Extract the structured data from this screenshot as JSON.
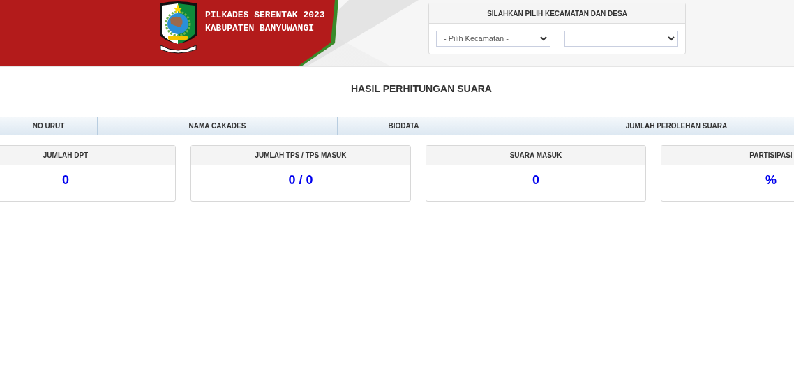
{
  "header": {
    "title_lines": [
      "PILKADES SERENTAK 2023",
      "KABUPATEN BANYUWANGI"
    ]
  },
  "filter_panel": {
    "title": "SILAHKAN PILIH KECAMATAN DAN DESA",
    "district_select": {
      "value": "- Pilih Kecamatan -"
    }
  },
  "section_title": "HASIL PERHITUNGAN SUARA",
  "table": {
    "columns": [
      "NO URUT",
      "NAMA CAKADES",
      "BIODATA",
      "JUMLAH PEROLEHAN SUARA"
    ]
  },
  "stats": [
    {
      "label": "JUMLAH DPT",
      "value": "0"
    },
    {
      "label": "JUMLAH TPS / TPS MASUK",
      "value": "0 / 0"
    },
    {
      "label": "SUARA MASUK",
      "value": "0"
    },
    {
      "label": "PARTISIPASI",
      "value": "%"
    }
  ]
}
